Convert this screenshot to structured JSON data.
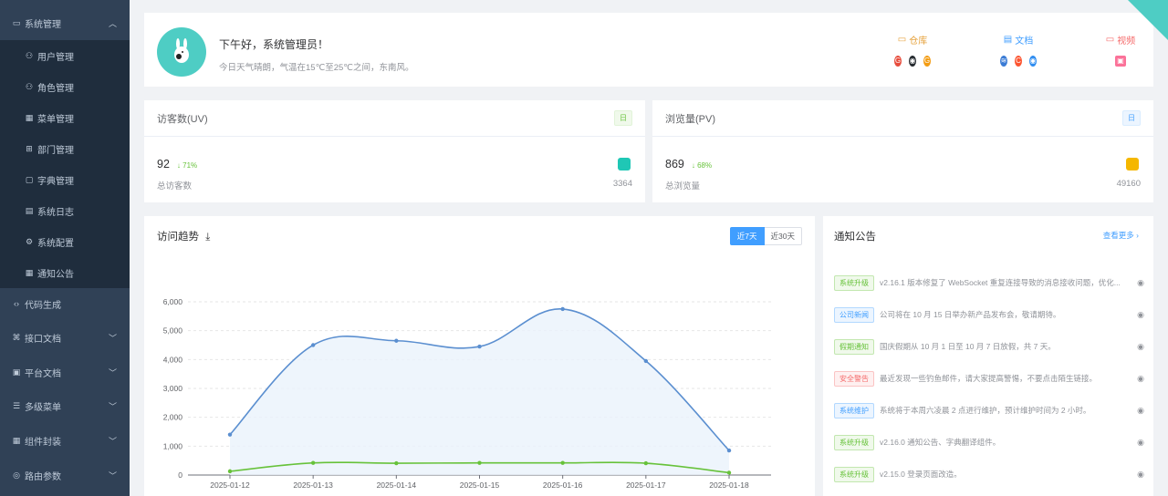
{
  "sidebar": {
    "items": [
      {
        "label": "系统管理",
        "icon": "monitor-icon",
        "level": "top",
        "arrow": "up"
      },
      {
        "label": "用户管理",
        "icon": "user-icon",
        "level": "sub"
      },
      {
        "label": "角色管理",
        "icon": "role-icon",
        "level": "sub"
      },
      {
        "label": "菜单管理",
        "icon": "menu-grid-icon",
        "level": "sub"
      },
      {
        "label": "部门管理",
        "icon": "org-icon",
        "level": "sub"
      },
      {
        "label": "字典管理",
        "icon": "dict-icon",
        "level": "sub"
      },
      {
        "label": "系统日志",
        "icon": "log-icon",
        "level": "sub"
      },
      {
        "label": "系统配置",
        "icon": "config-icon",
        "level": "sub"
      },
      {
        "label": "通知公告",
        "icon": "notice-icon",
        "level": "sub"
      },
      {
        "label": "代码生成",
        "icon": "code-icon",
        "level": "top"
      },
      {
        "label": "接口文档",
        "icon": "api-icon",
        "level": "top",
        "arrow": "down"
      },
      {
        "label": "平台文档",
        "icon": "doc-icon",
        "level": "top",
        "arrow": "down"
      },
      {
        "label": "多级菜单",
        "icon": "multi-menu-icon",
        "level": "top",
        "arrow": "down"
      },
      {
        "label": "组件封装",
        "icon": "component-icon",
        "level": "top",
        "arrow": "down"
      },
      {
        "label": "路由参数",
        "icon": "route-icon",
        "level": "top",
        "arrow": "down"
      }
    ]
  },
  "welcome": {
    "greeting": "下午好，系统管理员！",
    "weather": "今日天气晴朗，气温在15℃至25℃之间，东南风。"
  },
  "links": [
    {
      "label": "仓库",
      "color": "#e6a23c",
      "icon": "folder-icon"
    },
    {
      "label": "文档",
      "color": "#409eff",
      "icon": "document-icon"
    },
    {
      "label": "视频",
      "color": "#f56c6c",
      "icon": "video-icon"
    }
  ],
  "stats": [
    {
      "title": "访客数(UV)",
      "tag": "日",
      "value": "92",
      "change": "↓ 71%",
      "sub": "总访客数",
      "total": "3364",
      "badge_color": "#1fc7b5",
      "tag_bg": "#f0f9eb",
      "tag_color": "#67c23a"
    },
    {
      "title": "浏览量(PV)",
      "tag": "日",
      "value": "869",
      "change": "↓ 68%",
      "sub": "总浏览量",
      "total": "49160",
      "badge_color": "#f5b700",
      "tag_bg": "#ecf5ff",
      "tag_color": "#409eff"
    }
  ],
  "trend": {
    "title": "访问趋势",
    "download": "⤓",
    "seg_on": "近7天",
    "seg_off": "近30天"
  },
  "chart_data": {
    "type": "area",
    "x": [
      "2025-01-12",
      "2025-01-13",
      "2025-01-14",
      "2025-01-15",
      "2025-01-16",
      "2025-01-17",
      "2025-01-18"
    ],
    "series": [
      {
        "values": [
          1400,
          4500,
          4650,
          4450,
          5750,
          3950,
          850
        ],
        "color": "#5b8fd0"
      },
      {
        "values": [
          130,
          420,
          410,
          420,
          420,
          410,
          80
        ],
        "color": "#67c23a"
      }
    ],
    "yticks": [
      "0",
      "1,000",
      "2,000",
      "3,000",
      "4,000",
      "5,000",
      "6,000"
    ],
    "ylim": [
      0,
      6000
    ],
    "grid": true
  },
  "notices": {
    "title": "通知公告",
    "more": "查看更多 ›",
    "items": [
      {
        "tag": "系统升级",
        "tag_color": "#67c23a",
        "tag_bg": "#f0f9eb",
        "text": "v2.16.1 版本修复了 WebSocket 重复连接导致的消息接收问题，优化..."
      },
      {
        "tag": "公司新闻",
        "tag_color": "#409eff",
        "tag_bg": "#ecf5ff",
        "text": "公司将在 10 月 15 日举办新产品发布会，敬请期待。"
      },
      {
        "tag": "假期通知",
        "tag_color": "#67c23a",
        "tag_bg": "#f0f9eb",
        "text": "国庆假期从 10 月 1 日至 10 月 7 日放假，共 7 天。"
      },
      {
        "tag": "安全警告",
        "tag_color": "#f56c6c",
        "tag_bg": "#fef0f0",
        "text": "最近发现一些钓鱼邮件，请大家提高警惕，不要点击陌生链接。"
      },
      {
        "tag": "系统维护",
        "tag_color": "#409eff",
        "tag_bg": "#ecf5ff",
        "text": "系统将于本周六凌晨 2 点进行维护，预计维护时间为 2 小时。"
      },
      {
        "tag": "系统升级",
        "tag_color": "#67c23a",
        "tag_bg": "#f0f9eb",
        "text": "v2.16.0 通知公告、字典翻译组件。"
      },
      {
        "tag": "系统升级",
        "tag_color": "#67c23a",
        "tag_bg": "#f0f9eb",
        "text": "v2.15.0 登录页面改造。"
      }
    ]
  }
}
